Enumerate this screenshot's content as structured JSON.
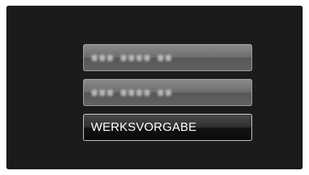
{
  "menu": {
    "items": [
      {
        "label": "",
        "state": "inactive",
        "blurred": true
      },
      {
        "label": "",
        "state": "inactive",
        "blurred": true
      },
      {
        "label": "WERKSVORGABE",
        "state": "selected",
        "blurred": false
      }
    ]
  },
  "colors": {
    "screen_background": "#1b1b1b",
    "inactive_button": "#6e6e6e",
    "active_button": "#1e1e1e",
    "active_border": "#d8d8d8",
    "label_text": "#ffffff"
  }
}
